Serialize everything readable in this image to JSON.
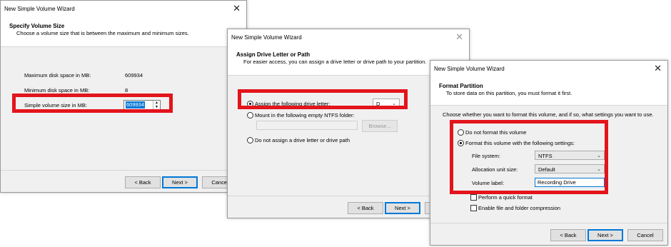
{
  "dialog1": {
    "title": "New Simple Volume Wizard",
    "close": "✕",
    "heading": "Specify Volume Size",
    "subheading": "Choose a volume size that is between the maximum and minimum sizes.",
    "max_label": "Maximum disk space in MB:",
    "max_value": "609934",
    "min_label": "Minimum disk space in MB:",
    "min_value": "8",
    "size_label": "Simple volume size in MB:",
    "size_value": "609934",
    "back": "< Back",
    "next": "Next >",
    "cancel": "Cancel"
  },
  "dialog2": {
    "title": "New Simple Volume Wizard",
    "close": "✕",
    "heading": "Assign Drive Letter or Path",
    "subheading": "For easier access, you can assign a drive letter or drive path to your partition.",
    "assign_label": "Assign the following drive letter:",
    "drive_letter": "D",
    "mount_label": "Mount in the following empty NTFS folder:",
    "browse": "Browse...",
    "none_label": "Do not assign a drive letter or drive path",
    "back": "< Back",
    "next": "Next >"
  },
  "dialog3": {
    "title": "New Simple Volume Wizard",
    "close": "✕",
    "heading": "Format Partition",
    "subheading": "To store data on this partition, you must format it first.",
    "intro": "Choose whether you want to format this volume, and if so, what settings you want to use.",
    "no_format_label": "Do not format this volume",
    "format_label": "Format this volume with the following settings:",
    "fs_label": "File system:",
    "fs_value": "NTFS",
    "alloc_label": "Allocation unit size:",
    "alloc_value": "Default",
    "vol_label": "Volume label:",
    "vol_value": "Recording Drive",
    "quick_label": "Perform a quick format",
    "compress_label": "Enable file and folder compression",
    "back": "< Back",
    "next": "Next >",
    "cancel": "Cancel"
  },
  "colors": {
    "highlight": "#e3141b",
    "accent": "#0078d7",
    "dialog_bg": "#f0f0f0"
  }
}
